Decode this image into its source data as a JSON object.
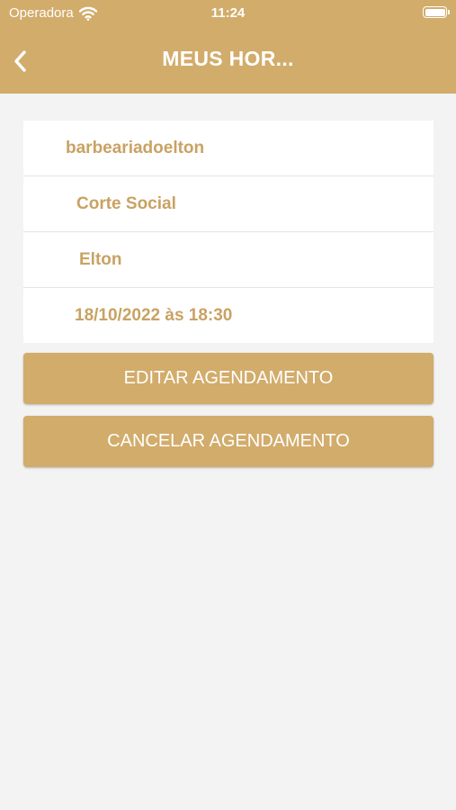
{
  "status_bar": {
    "carrier": "Operadora",
    "time": "11:24"
  },
  "nav": {
    "title": "MEUS HOR..."
  },
  "appointment": {
    "shop": "barbeariadoelton",
    "service": "Corte Social",
    "barber": "Elton",
    "datetime": "18/10/2022 às 18:30"
  },
  "actions": {
    "edit_label": "EDITAR AGENDAMENTO",
    "cancel_label": "CANCELAR AGENDAMENTO"
  },
  "colors": {
    "accent": "#d2ac6b",
    "text_accent": "#c9a263",
    "background": "#f3f3f3"
  },
  "icons": {
    "back": "chevron-left-icon",
    "wifi": "wifi-icon",
    "battery": "battery-icon"
  }
}
